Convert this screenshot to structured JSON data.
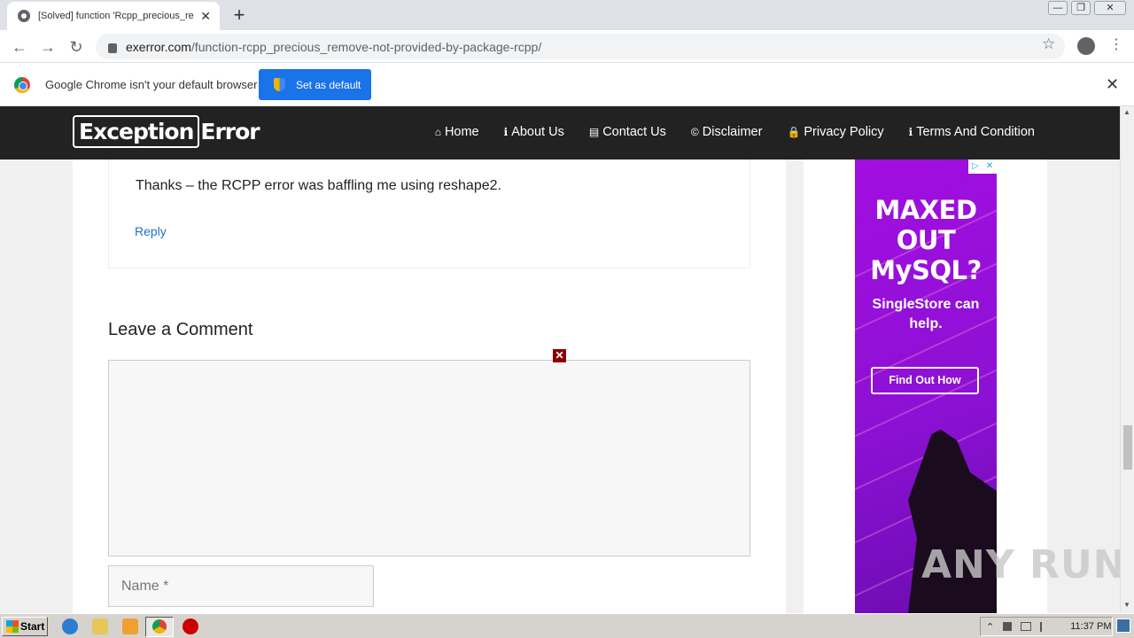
{
  "browser": {
    "tab_title": "[Solved] function 'Rcpp_precious_re",
    "tab_close": "✕",
    "new_tab": "+",
    "url_domain": "exerror.com",
    "url_path": "/function-rcpp_precious_remove-not-provided-by-package-rcpp/",
    "back": "←",
    "forward": "→",
    "reload": "↻",
    "star": "☆",
    "menu": "⋮",
    "win_min": "—",
    "win_max": "❐",
    "win_close": "✕"
  },
  "infobar": {
    "message": "Google Chrome isn't your default browser",
    "button": "Set as default",
    "close": "✕"
  },
  "site": {
    "logo_box": "Exception",
    "logo_rest": "Error",
    "nav": [
      {
        "icon": "⌂",
        "label": "Home"
      },
      {
        "icon": "ℹ",
        "label": "About Us"
      },
      {
        "icon": "▤",
        "label": "Contact Us"
      },
      {
        "icon": "©",
        "label": "Disclaimer"
      },
      {
        "icon": "🔒",
        "label": "Privacy Policy"
      },
      {
        "icon": "ℹ",
        "label": "Terms And Condition"
      }
    ]
  },
  "comment": {
    "text": "Thanks – the RCPP error was baffling me using reshape2.",
    "reply": "Reply"
  },
  "form": {
    "title": "Leave a Comment",
    "close_x": "✕",
    "name_placeholder": "Name *"
  },
  "ad": {
    "headline": "MAXED OUT MySQL?",
    "sub": "SingleStore can help.",
    "cta": "Find Out How",
    "badge_play": "▷",
    "badge_x": "✕"
  },
  "watermark": "ANY RUN",
  "scrollbar": {
    "up": "▲",
    "down": "▼"
  },
  "taskbar": {
    "start": "Start",
    "tray_up": "⌃",
    "clock": "11:37 PM"
  }
}
